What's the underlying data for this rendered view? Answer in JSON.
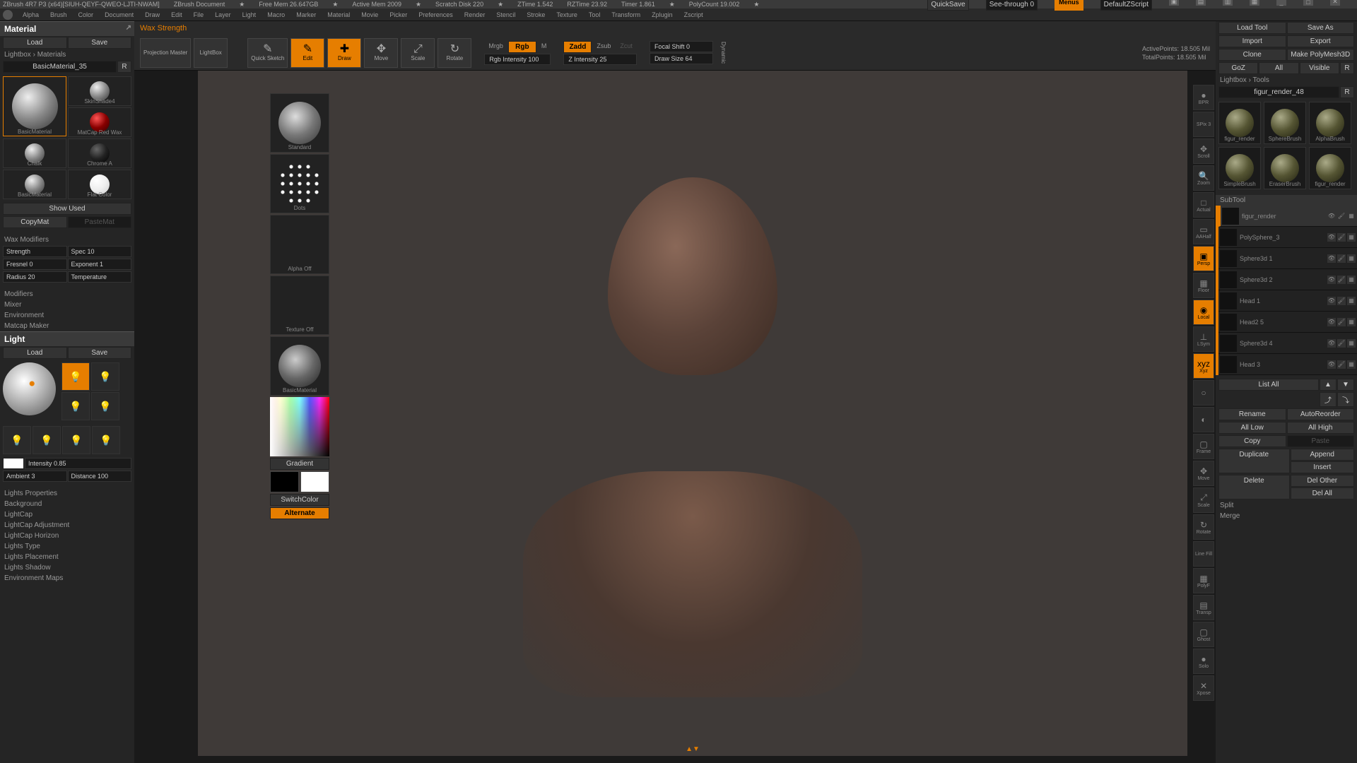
{
  "titlebar": {
    "app": "ZBrush 4R7 P3  (x64)[SIUH-QEYF-QWEO-LJTI-NWAM]",
    "doc": "ZBrush Document",
    "freemem": "Free Mem  26.647GB",
    "activemem": "Active Mem  2009",
    "scratch": "Scratch Disk  220",
    "ztime": "ZTime  1.542",
    "rztime": "RZTime  23.92",
    "timer": "Timer  1.861",
    "polycount": "PolyCount  19.002",
    "quicksave": "QuickSave",
    "seethrough": "See-through  0",
    "menus": "Menus",
    "script": "DefaultZScript"
  },
  "menus": [
    "Alpha",
    "Brush",
    "Color",
    "Document",
    "Draw",
    "Edit",
    "File",
    "Layer",
    "Light",
    "Macro",
    "Marker",
    "Material",
    "Movie",
    "Picker",
    "Preferences",
    "Render",
    "Stencil",
    "Stroke",
    "Texture",
    "Tool",
    "Transform",
    "Zplugin",
    "Zscript"
  ],
  "left": {
    "material_title": "Material",
    "load": "Load",
    "save": "Save",
    "lightbox_mat": "Lightbox › Materials",
    "basic35": "BasicMaterial_35",
    "r": "R",
    "swatches": [
      {
        "name": "BasicMaterial",
        "sel": true
      },
      {
        "name": "SkinShade4"
      },
      {
        "name": "MatCap Red Wax",
        "color": "red"
      },
      {
        "name": "Chalk"
      },
      {
        "name": "Chrome A",
        "color": "dark"
      },
      {
        "name": "BasicMaterial"
      },
      {
        "name": "Flat Color",
        "color": "flat"
      }
    ],
    "show_used": "Show Used",
    "copymat": "CopyMat",
    "pastemat": "PasteMat",
    "wax_mod": "Wax Modifiers",
    "wax_strength": "Strength",
    "wax_spec": "Spec 10",
    "wax_fresnel": "Fresnel 0",
    "wax_exponent": "Exponent 1",
    "wax_radius": "Radius 20",
    "wax_temp": "Temperature",
    "modifiers": "Modifiers",
    "mixer": "Mixer",
    "environment": "Environment",
    "matcap": "Matcap Maker",
    "light_title": "Light",
    "intensity": "Intensity 0.85",
    "ambient": "Ambient 3",
    "distance": "Distance 100",
    "light_sections": [
      "Lights Properties",
      "Background",
      "LightCap",
      "LightCap Adjustment",
      "LightCap Horizon",
      "Lights Type",
      "Lights Placement",
      "Lights Shadow",
      "Environment Maps"
    ]
  },
  "hint": "Wax Strength",
  "toolbar": {
    "projection": "Projection Master",
    "lightbox": "LightBox",
    "quicksketch": "Quick Sketch",
    "edit": "Edit",
    "draw": "Draw",
    "move": "Move",
    "scale": "Scale",
    "rotate": "Rotate",
    "mrgb": "Mrgb",
    "rgb": "Rgb",
    "m": "M",
    "rgbint": "Rgb Intensity 100",
    "zadd": "Zadd",
    "zsub": "Zsub",
    "zcut": "Zcut",
    "zint": "Z Intensity 25",
    "focal": "Focal Shift 0",
    "drawsize": "Draw Size 64",
    "dynamic": "Dynamic",
    "activepts": "ActivePoints: 18.505 Mil",
    "totalpts": "TotalPoints: 18.505 Mil"
  },
  "brushcol": {
    "standard": "Standard",
    "dots": "Dots",
    "alpha": "Alpha Off",
    "texture": "Texture Off",
    "basicmat": "BasicMaterial",
    "gradient": "Gradient",
    "switchcolor": "SwitchColor",
    "alternate": "Alternate"
  },
  "riconbar": [
    {
      "label": "BPR",
      "ic": "●"
    },
    {
      "label": "SPix 3",
      "ic": ""
    },
    {
      "label": "Scroll",
      "ic": "✥"
    },
    {
      "label": "Zoom",
      "ic": "🔍"
    },
    {
      "label": "Actual",
      "ic": "□"
    },
    {
      "label": "AAHalf",
      "ic": "▭"
    },
    {
      "label": "Persp",
      "ic": "▣",
      "orange": true
    },
    {
      "label": "Floor",
      "ic": "▦"
    },
    {
      "label": "Local",
      "ic": "◉",
      "orange": true
    },
    {
      "label": "LSym",
      "ic": "⊥"
    },
    {
      "label": "Xyz",
      "ic": "xyz",
      "orange": true
    },
    {
      "label": "",
      "ic": "○"
    },
    {
      "label": "",
      "ic": "◐"
    },
    {
      "label": "Frame",
      "ic": "▢"
    },
    {
      "label": "Move",
      "ic": "✥"
    },
    {
      "label": "Scale",
      "ic": "⤢"
    },
    {
      "label": "Rotate",
      "ic": "↻"
    },
    {
      "label": "Line Fill",
      "ic": ""
    },
    {
      "label": "PolyF",
      "ic": "▦"
    },
    {
      "label": "Transp",
      "ic": "▤"
    },
    {
      "label": "Ghost",
      "ic": "▢"
    },
    {
      "label": "Solo",
      "ic": "●"
    },
    {
      "label": "Xpose",
      "ic": "✕"
    }
  ],
  "right": {
    "save_tool": "Save As",
    "load_tool": "Load Tool",
    "import": "Import",
    "export": "Export",
    "clone": "Clone",
    "makepoly": "Make PolyMesh3D",
    "goz": "GoZ",
    "all": "All",
    "visible": "Visible",
    "r": "R",
    "lightbox_tools": "Lightbox › Tools",
    "figur": "figur_render_48",
    "tools": [
      {
        "name": "figur_render"
      },
      {
        "name": "SphereBrush"
      },
      {
        "name": "AlphaBrush"
      },
      {
        "name": "SimpleBrush"
      },
      {
        "name": "EraserBrush"
      },
      {
        "name": "figur_render"
      }
    ],
    "subtool": "SubTool",
    "subtools": [
      {
        "name": "figur_render",
        "sel": true
      },
      {
        "name": "PolySphere_3"
      },
      {
        "name": "Sphere3d 1"
      },
      {
        "name": "Sphere3d 2"
      },
      {
        "name": "Head 1"
      },
      {
        "name": "Head2 5"
      },
      {
        "name": "Sphere3d 4"
      },
      {
        "name": "Head 3"
      }
    ],
    "listall": "List All",
    "rename": "Rename",
    "autoreorder": "AutoReorder",
    "alllow": "All Low",
    "allhigh": "All High",
    "copy": "Copy",
    "paste": "Paste",
    "duplicate": "Duplicate",
    "append": "Append",
    "insert": "Insert",
    "delete": "Delete",
    "delother": "Del Other",
    "delall": "Del All",
    "split": "Split",
    "merge": "Merge"
  }
}
